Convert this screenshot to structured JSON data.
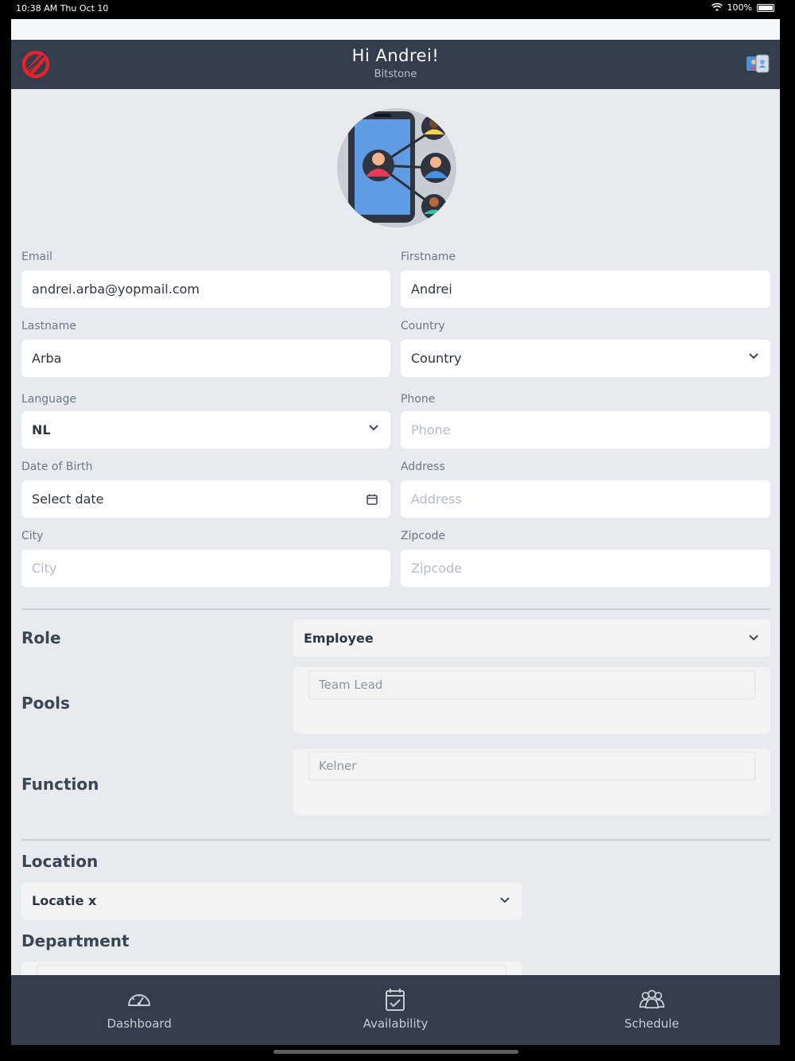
{
  "status_bar": {
    "time": "10:38 AM   Thu Oct 10",
    "battery": "100%"
  },
  "header": {
    "greeting": "Hi Andrei!",
    "company": "Bitstone"
  },
  "form": {
    "email": {
      "label": "Email",
      "value": "andrei.arba@yopmail.com"
    },
    "firstname": {
      "label": "Firstname",
      "value": "Andrei"
    },
    "lastname": {
      "label": "Lastname",
      "value": "Arba"
    },
    "country": {
      "label": "Country",
      "value": "Country"
    },
    "language": {
      "label": "Language",
      "value": "NL"
    },
    "phone": {
      "label": "Phone",
      "placeholder": "Phone"
    },
    "dob": {
      "label": "Date of Birth",
      "value": "Select date"
    },
    "address": {
      "label": "Address",
      "placeholder": "Address"
    },
    "city": {
      "label": "City",
      "placeholder": "City"
    },
    "zipcode": {
      "label": "Zipcode",
      "placeholder": "Zipcode"
    }
  },
  "role": {
    "label": "Role",
    "value": "Employee"
  },
  "pools": {
    "label": "Pools",
    "tag": "Team Lead"
  },
  "function": {
    "label": "Function",
    "tag": "Kelner"
  },
  "location": {
    "label": "Location",
    "value": "Locatie x"
  },
  "department": {
    "label": "Department"
  },
  "tabs": [
    {
      "label": "Dashboard",
      "icon": "speedometer-icon"
    },
    {
      "label": "Availability",
      "icon": "calendar-check-icon"
    },
    {
      "label": "Schedule",
      "icon": "group-icon"
    }
  ],
  "colors": {
    "header_bg": "#333d4c",
    "page_bg": "#e8eaed",
    "logo_red": "#e3232b"
  }
}
